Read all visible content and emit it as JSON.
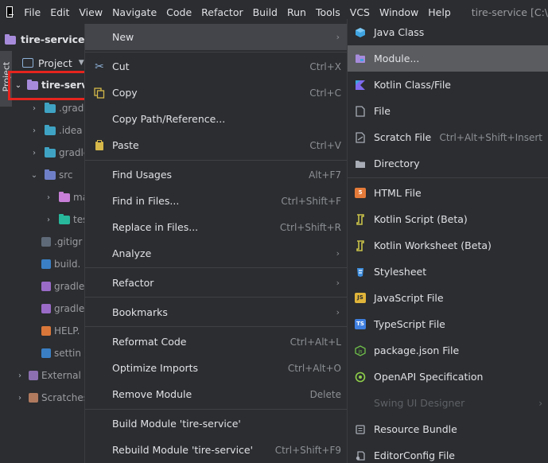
{
  "menubar": {
    "items": [
      "File",
      "Edit",
      "View",
      "Navigate",
      "Code",
      "Refactor",
      "Build",
      "Run",
      "Tools",
      "VCS",
      "Window",
      "Help"
    ],
    "window_title": "tire-service [C:\\"
  },
  "project": {
    "title": "tire-service",
    "panel_label": "Project",
    "side_tab": "Project"
  },
  "tree": {
    "root": "tire-serv",
    "items": [
      ".gradl",
      ".idea",
      "gradle",
      "src",
      "ma",
      "tes",
      ".gitigr",
      "build.",
      "gradle",
      "gradle",
      "HELP.",
      "settin",
      "External I",
      "Scratches"
    ]
  },
  "context_menu": {
    "new": "New",
    "cut": "Cut",
    "cut_sc": "Ctrl+X",
    "copy": "Copy",
    "copy_sc": "Ctrl+C",
    "copy_path": "Copy Path/Reference...",
    "paste": "Paste",
    "paste_sc": "Ctrl+V",
    "find_usages": "Find Usages",
    "find_usages_sc": "Alt+F7",
    "find_in_files": "Find in Files...",
    "find_in_files_sc": "Ctrl+Shift+F",
    "replace_in_files": "Replace in Files...",
    "replace_in_files_sc": "Ctrl+Shift+R",
    "analyze": "Analyze",
    "refactor": "Refactor",
    "bookmarks": "Bookmarks",
    "reformat": "Reformat Code",
    "reformat_sc": "Ctrl+Alt+L",
    "optimize": "Optimize Imports",
    "optimize_sc": "Ctrl+Alt+O",
    "remove_module": "Remove Module",
    "remove_module_sc": "Delete",
    "build_module": "Build Module 'tire-service'",
    "rebuild_module": "Rebuild Module 'tire-service'",
    "rebuild_module_sc": "Ctrl+Shift+F9"
  },
  "submenu": {
    "java_class": "Java Class",
    "module": "Module...",
    "kotlin_class": "Kotlin Class/File",
    "file": "File",
    "scratch": "Scratch File",
    "scratch_sc": "Ctrl+Alt+Shift+Insert",
    "directory": "Directory",
    "html": "HTML File",
    "kotlin_script": "Kotlin Script (Beta)",
    "kotlin_worksheet": "Kotlin Worksheet (Beta)",
    "stylesheet": "Stylesheet",
    "javascript": "JavaScript File",
    "typescript": "TypeScript File",
    "package_json": "package.json File",
    "openapi": "OpenAPI Specification",
    "swing": "Swing UI Designer",
    "resource_bundle": "Resource Bundle",
    "editorconfig": "EditorConfig File"
  },
  "colors": {
    "background": "#2b2d30",
    "highlight": "#5a5c60",
    "selection_outline": "#e5241f"
  }
}
